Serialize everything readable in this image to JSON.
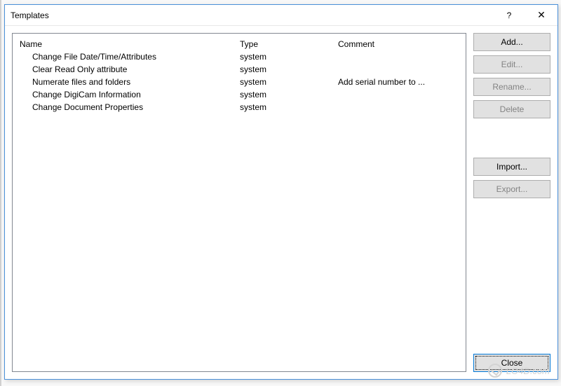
{
  "window": {
    "title": "Templates",
    "help_glyph": "?",
    "close_glyph": "✕"
  },
  "columns": {
    "name": "Name",
    "type": "Type",
    "comment": "Comment"
  },
  "rows": [
    {
      "name": "Change File Date/Time/Attributes",
      "type": "system",
      "comment": ""
    },
    {
      "name": "Clear Read Only attribute",
      "type": "system",
      "comment": ""
    },
    {
      "name": "Numerate files and folders",
      "type": "system",
      "comment": "Add serial number to ..."
    },
    {
      "name": "Change DigiCam Information",
      "type": "system",
      "comment": ""
    },
    {
      "name": "Change Document Properties",
      "type": "system",
      "comment": ""
    }
  ],
  "buttons": {
    "add": "Add...",
    "edit": "Edit...",
    "rename": "Rename...",
    "delete": "Delete",
    "import": "Import...",
    "export": "Export...",
    "close": "Close"
  },
  "watermark": "LO4D.com"
}
